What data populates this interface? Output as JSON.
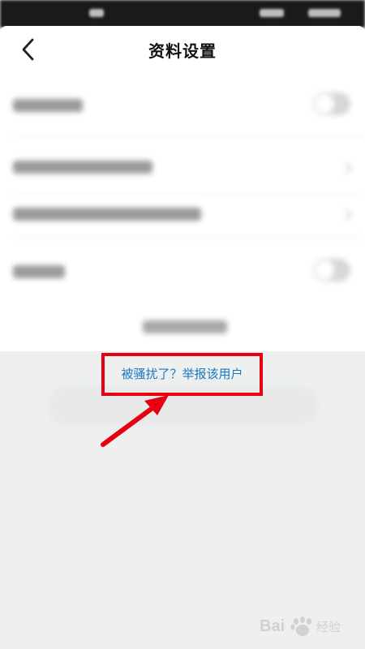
{
  "nav": {
    "title": "资料设置"
  },
  "report": {
    "link_text": "被骚扰了？举报该用户"
  },
  "watermark": {
    "brand": "Bai百度经验"
  }
}
